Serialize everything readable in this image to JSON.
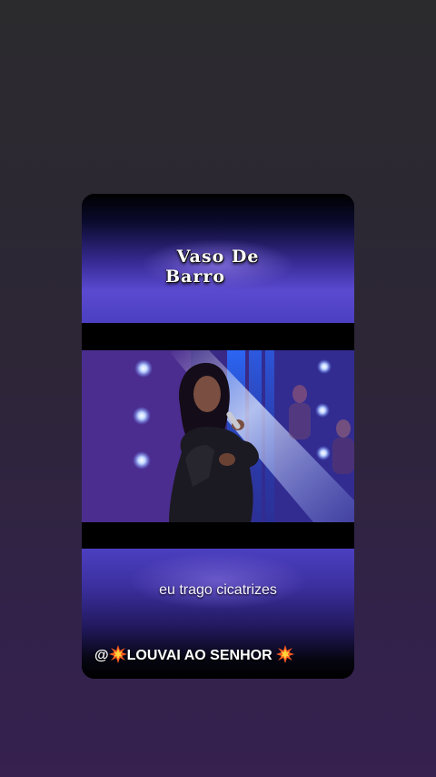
{
  "video_title": {
    "line1": "Vaso  De",
    "line2": "Barro"
  },
  "lyric_caption": "eu trago cicatrizes",
  "channel_tag": {
    "prefix": "@",
    "name": "LOUVAI AO SENHOR",
    "icon": "collision-burst-icon"
  },
  "colors": {
    "background_top": "#2b2b2e",
    "background_bottom": "#36214f",
    "band_accent": "#4c3fc0",
    "stage_light": "#8fb6ff"
  }
}
